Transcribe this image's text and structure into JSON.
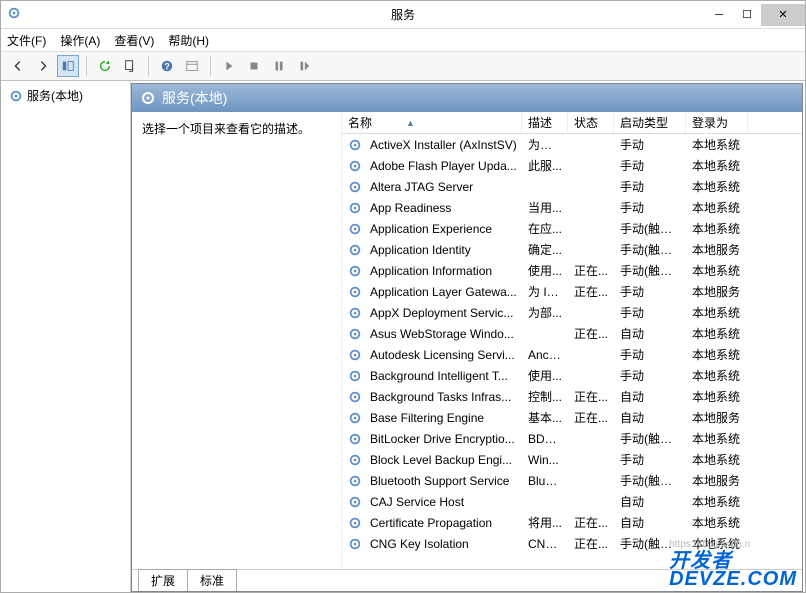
{
  "window": {
    "title": "服务"
  },
  "menu": {
    "file": "文件(F)",
    "action": "操作(A)",
    "view": "查看(V)",
    "help": "帮助(H)"
  },
  "tree": {
    "root": "服务(本地)"
  },
  "panel": {
    "title": "服务(本地)",
    "desc_prompt": "选择一个项目来查看它的描述。"
  },
  "columns": {
    "name": "名称",
    "desc": "描述",
    "status": "状态",
    "start": "启动类型",
    "logon": "登录为"
  },
  "tabs": {
    "ext": "扩展",
    "std": "标准"
  },
  "watermark": {
    "line1": "开发者",
    "line2": "DEVZE.COM",
    "url": "https://blog.csdn.n"
  },
  "services": [
    {
      "name": "ActiveX Installer (AxInstSV)",
      "desc": "为从 ...",
      "status": "",
      "start": "手动",
      "logon": "本地系统"
    },
    {
      "name": "Adobe Flash Player Upda...",
      "desc": "此服...",
      "status": "",
      "start": "手动",
      "logon": "本地系统"
    },
    {
      "name": "Altera JTAG Server",
      "desc": "",
      "status": "",
      "start": "手动",
      "logon": "本地系统"
    },
    {
      "name": "App Readiness",
      "desc": "当用...",
      "status": "",
      "start": "手动",
      "logon": "本地系统"
    },
    {
      "name": "Application Experience",
      "desc": "在应...",
      "status": "",
      "start": "手动(触发...",
      "logon": "本地系统"
    },
    {
      "name": "Application Identity",
      "desc": "确定...",
      "status": "",
      "start": "手动(触发...",
      "logon": "本地服务"
    },
    {
      "name": "Application Information",
      "desc": "使用...",
      "status": "正在...",
      "start": "手动(触发...",
      "logon": "本地系统"
    },
    {
      "name": "Application Layer Gatewa...",
      "desc": "为 In...",
      "status": "正在...",
      "start": "手动",
      "logon": "本地服务"
    },
    {
      "name": "AppX Deployment Servic...",
      "desc": "为部...",
      "status": "",
      "start": "手动",
      "logon": "本地系统"
    },
    {
      "name": "Asus WebStorage Windo...",
      "desc": "",
      "status": "正在...",
      "start": "自动",
      "logon": "本地系统"
    },
    {
      "name": "Autodesk Licensing Servi...",
      "desc": "Anch...",
      "status": "",
      "start": "手动",
      "logon": "本地系统"
    },
    {
      "name": "Background Intelligent T...",
      "desc": "使用...",
      "status": "",
      "start": "手动",
      "logon": "本地系统"
    },
    {
      "name": "Background Tasks Infras...",
      "desc": "控制...",
      "status": "正在...",
      "start": "自动",
      "logon": "本地系统"
    },
    {
      "name": "Base Filtering Engine",
      "desc": "基本...",
      "status": "正在...",
      "start": "自动",
      "logon": "本地服务"
    },
    {
      "name": "BitLocker Drive Encryptio...",
      "desc": "BDE...",
      "status": "",
      "start": "手动(触发...",
      "logon": "本地系统"
    },
    {
      "name": "Block Level Backup Engi...",
      "desc": "Win...",
      "status": "",
      "start": "手动",
      "logon": "本地系统"
    },
    {
      "name": "Bluetooth Support Service",
      "desc": "Blue...",
      "status": "",
      "start": "手动(触发...",
      "logon": "本地服务"
    },
    {
      "name": "CAJ Service Host",
      "desc": "",
      "status": "",
      "start": "自动",
      "logon": "本地系统"
    },
    {
      "name": "Certificate Propagation",
      "desc": "将用...",
      "status": "正在...",
      "start": "自动",
      "logon": "本地系统"
    },
    {
      "name": "CNG Key Isolation",
      "desc": "CNG...",
      "status": "正在...",
      "start": "手动(触发...",
      "logon": "本地系统"
    }
  ]
}
